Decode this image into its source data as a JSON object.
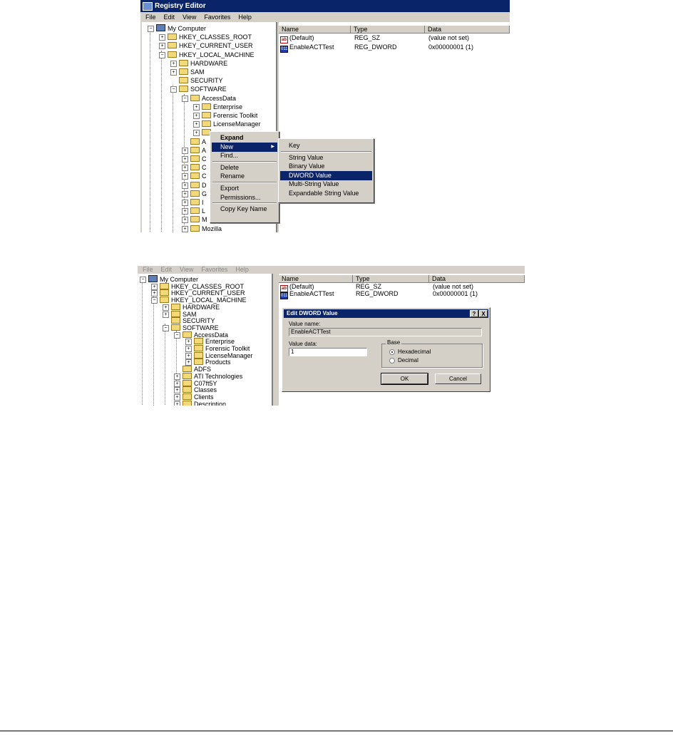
{
  "top": {
    "title": "Registry Editor",
    "menu": [
      "File",
      "Edit",
      "View",
      "Favorites",
      "Help"
    ],
    "tree": [
      {
        "label": "My Computer",
        "icon": "computer-icon",
        "level": 0,
        "expander": "minus"
      },
      {
        "label": "HKEY_CLASSES_ROOT",
        "level": 1,
        "expander": "plus"
      },
      {
        "label": "HKEY_CURRENT_USER",
        "level": 1,
        "expander": "plus"
      },
      {
        "label": "HKEY_LOCAL_MACHINE",
        "level": 1,
        "expander": "minus"
      },
      {
        "label": "HARDWARE",
        "level": 2,
        "expander": "plus"
      },
      {
        "label": "SAM",
        "level": 2,
        "expander": "plus"
      },
      {
        "label": "SECURITY",
        "level": 2,
        "expander": "none"
      },
      {
        "label": "SOFTWARE",
        "level": 2,
        "expander": "minus"
      },
      {
        "label": "AccessData",
        "level": 3,
        "expander": "minus"
      },
      {
        "label": "Enterprise",
        "level": 4,
        "expander": "plus"
      },
      {
        "label": "Forensic Toolkit",
        "level": 4,
        "expander": "plus"
      },
      {
        "label": "LicenseManager",
        "level": 4,
        "expander": "plus"
      },
      {
        "label": "",
        "level": 4,
        "expander": "plus"
      },
      {
        "label": "A",
        "level": 3,
        "expander": "none"
      },
      {
        "label": "A",
        "level": 3,
        "expander": "plus"
      },
      {
        "label": "C",
        "level": 3,
        "expander": "plus"
      },
      {
        "label": "C",
        "level": 3,
        "expander": "plus"
      },
      {
        "label": "C",
        "level": 3,
        "expander": "plus"
      },
      {
        "label": "D",
        "level": 3,
        "expander": "plus"
      },
      {
        "label": "G",
        "level": 3,
        "expander": "plus"
      },
      {
        "label": "I",
        "level": 3,
        "expander": "plus"
      },
      {
        "label": "L",
        "level": 3,
        "expander": "plus"
      },
      {
        "label": "M",
        "level": 3,
        "expander": "plus"
      },
      {
        "label": "Mozilla",
        "level": 3,
        "expander": "plus"
      }
    ],
    "columns": [
      "Name",
      "Type",
      "Data"
    ],
    "values": [
      {
        "name": "(Default)",
        "type": "REG_SZ",
        "data": "(value not set)",
        "icon": "string-value-icon",
        "icon_text": "ab"
      },
      {
        "name": "EnableACTTest",
        "type": "REG_DWORD",
        "data": "0x00000001 (1)",
        "icon": "dword-value-icon",
        "icon_text": "011"
      }
    ],
    "context_menu": [
      {
        "label": "Expand",
        "bold": true
      },
      {
        "label": "New",
        "selected": true,
        "submenu": true
      },
      {
        "label": "Find...",
        "separator_after": true
      },
      {
        "label": "Delete"
      },
      {
        "label": "Rename",
        "separator_after": true
      },
      {
        "label": "Export"
      },
      {
        "label": "Permissions...",
        "separator_after": true
      },
      {
        "label": "Copy Key Name"
      }
    ],
    "submenu": [
      {
        "label": "Key",
        "separator_after": true
      },
      {
        "label": "String Value"
      },
      {
        "label": "Binary Value"
      },
      {
        "label": "DWORD Value",
        "selected": true
      },
      {
        "label": "Multi-String Value"
      },
      {
        "label": "Expandable String Value"
      }
    ]
  },
  "bottom": {
    "menu": [
      "File",
      "Edit",
      "View",
      "Favorites",
      "Help"
    ],
    "tree": [
      {
        "label": "My Computer",
        "level": 0,
        "expander": "minus"
      },
      {
        "label": "HKEY_CLASSES_ROOT",
        "level": 1,
        "expander": "plus"
      },
      {
        "label": "HKEY_CURRENT_USER",
        "level": 1,
        "expander": "plus"
      },
      {
        "label": "HKEY_LOCAL_MACHINE",
        "level": 1,
        "expander": "minus"
      },
      {
        "label": "HARDWARE",
        "level": 2,
        "expander": "plus"
      },
      {
        "label": "SAM",
        "level": 2,
        "expander": "plus"
      },
      {
        "label": "SECURITY",
        "level": 2,
        "expander": "none"
      },
      {
        "label": "SOFTWARE",
        "level": 2,
        "expander": "minus"
      },
      {
        "label": "AccessData",
        "level": 3,
        "expander": "minus"
      },
      {
        "label": "Enterprise",
        "level": 4,
        "expander": "plus"
      },
      {
        "label": "Forensic Toolkit",
        "level": 4,
        "expander": "plus"
      },
      {
        "label": "LicenseManager",
        "level": 4,
        "expander": "plus"
      },
      {
        "label": "Products",
        "level": 4,
        "expander": "plus"
      },
      {
        "label": "ADFS",
        "level": 3,
        "expander": "none"
      },
      {
        "label": "ATI Technologies",
        "level": 3,
        "expander": "plus"
      },
      {
        "label": "C07ft5Y",
        "level": 3,
        "expander": "plus"
      },
      {
        "label": "Classes",
        "level": 3,
        "expander": "plus"
      },
      {
        "label": "Clients",
        "level": 3,
        "expander": "plus"
      },
      {
        "label": "Description",
        "level": 3,
        "expander": "plus"
      }
    ],
    "columns": [
      "Name",
      "Type",
      "Data"
    ],
    "values": [
      {
        "name": "(Default)",
        "type": "REG_SZ",
        "data": "(value not set)",
        "icon": "string-value-icon",
        "icon_text": "ab"
      },
      {
        "name": "EnableACTTest",
        "type": "REG_DWORD",
        "data": "0x00000001 (1)",
        "icon": "dword-value-icon",
        "icon_text": "011"
      }
    ],
    "dialog": {
      "title": "Edit DWORD Value",
      "help_button": "?",
      "close_button": "X",
      "value_name_label": "Value name:",
      "value_name": "EnableACTTest",
      "value_data_label": "Value data:",
      "value_data": "1",
      "base_label": "Base",
      "hex_label": "Hexadecimal",
      "dec_label": "Decimal",
      "selected_base": "Hexadecimal",
      "ok_label": "OK",
      "cancel_label": "Cancel"
    }
  }
}
